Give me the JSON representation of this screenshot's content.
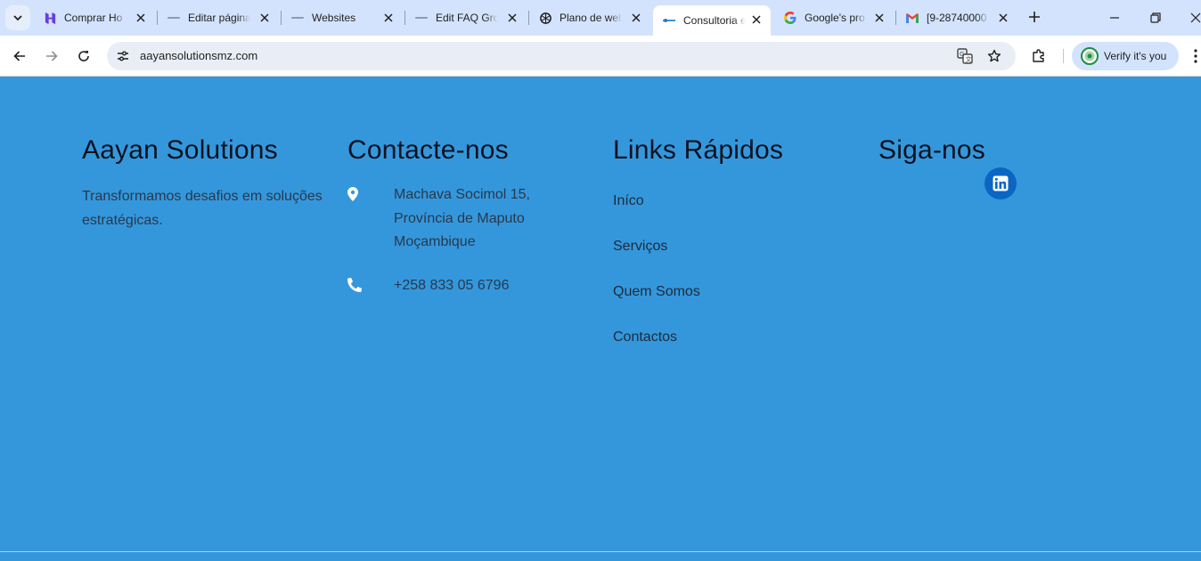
{
  "browser": {
    "tabs": [
      {
        "title": "Comprar Ho",
        "icon": "hostinger-icon",
        "active": false
      },
      {
        "title": "Editar página",
        "icon": "generic-page-icon",
        "active": false
      },
      {
        "title": "Websites",
        "icon": "generic-page-icon",
        "active": false
      },
      {
        "title": "Edit FAQ Gro",
        "icon": "generic-page-icon",
        "active": false
      },
      {
        "title": "Plano de web",
        "icon": "openai-icon",
        "active": false
      },
      {
        "title": "Consultoria e",
        "icon": "site-favicon",
        "active": true
      },
      {
        "title": "Google's pro",
        "icon": "google-icon",
        "active": false
      },
      {
        "title": "[9-28740000",
        "icon": "gmail-icon",
        "active": false
      }
    ],
    "url": "aayansolutionsmz.com",
    "verify_label": "Verify it's you"
  },
  "footer": {
    "company": {
      "title": "Aayan Solutions",
      "description": "Transformamos desafios em soluções estratégicas."
    },
    "contact": {
      "title": "Contacte-nos",
      "address_line1": "Machava Socimol 15,",
      "address_line2": "Província de Maputo",
      "address_line3": "Moçambique",
      "phone": "+258 833 05 6796"
    },
    "links": {
      "title": "Links Rápidos",
      "items": [
        "Iníco",
        "Serviços",
        "Quem Somos",
        "Contactos"
      ]
    },
    "social": {
      "title": "Siga-nos",
      "network": "linkedin-icon"
    }
  },
  "colors": {
    "page_bg": "#3597db",
    "tabstrip_bg": "#d3e3fd",
    "linkedin": "#0a66c2"
  }
}
